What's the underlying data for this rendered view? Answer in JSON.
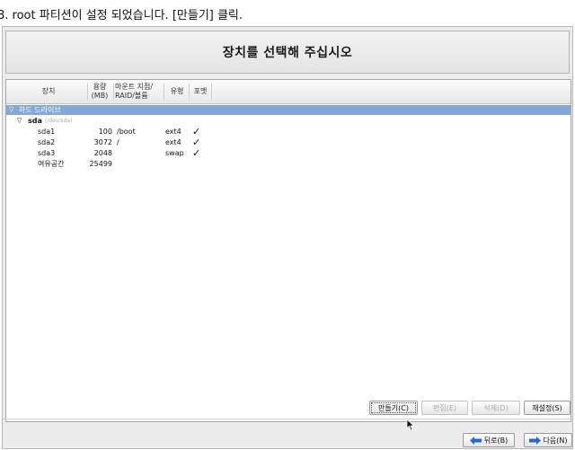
{
  "caption": "8. root 파티션이 설정 되었습니다. [만들기] 클릭.",
  "header": {
    "title": "장치를 선택해 주십시오"
  },
  "columns": {
    "device": "장치",
    "size_line1": "용량",
    "size_line2": "(MB)",
    "mount_line1": "마운트 지점/",
    "mount_line2": "RAID/볼륨",
    "type": "유형",
    "format": "포맷"
  },
  "tree": {
    "group_label": "하드 드라이브",
    "disk_name": "sda",
    "disk_path": "(/dev/sda)",
    "partitions": [
      {
        "device": "sda1",
        "size": "100",
        "mount": "/boot",
        "type": "ext4",
        "format": "✓"
      },
      {
        "device": "sda2",
        "size": "3072",
        "mount": "/",
        "type": "ext4",
        "format": "✓"
      },
      {
        "device": "sda3",
        "size": "2048",
        "mount": "",
        "type": "swap",
        "format": "✓"
      },
      {
        "device": "여유공간",
        "size": "25499",
        "mount": "",
        "type": "",
        "format": ""
      }
    ]
  },
  "actions": {
    "create": "만들기(C)",
    "edit": "편집(E)",
    "delete": "삭제(D)",
    "reset": "재설정(S)"
  },
  "nav": {
    "back": "뒤로(B)",
    "next": "다음(N)"
  },
  "colors": {
    "selection": "#86a8d8",
    "arrow_blue": "#2a66c8"
  },
  "icons": {
    "expander": "triangle-down-icon",
    "check": "checkmark-icon",
    "back": "left-arrow-icon",
    "next": "right-arrow-icon",
    "cursor": "mouse-pointer-icon"
  }
}
